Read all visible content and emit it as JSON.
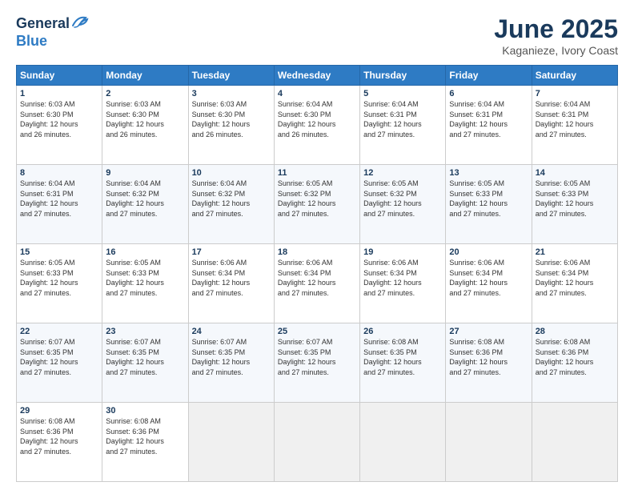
{
  "header": {
    "logo_line1": "General",
    "logo_line2": "Blue",
    "title": "June 2025",
    "subtitle": "Kaganieze, Ivory Coast"
  },
  "days_of_week": [
    "Sunday",
    "Monday",
    "Tuesday",
    "Wednesday",
    "Thursday",
    "Friday",
    "Saturday"
  ],
  "weeks": [
    [
      {
        "day": "1",
        "info": "Sunrise: 6:03 AM\nSunset: 6:30 PM\nDaylight: 12 hours\nand 26 minutes."
      },
      {
        "day": "2",
        "info": "Sunrise: 6:03 AM\nSunset: 6:30 PM\nDaylight: 12 hours\nand 26 minutes."
      },
      {
        "day": "3",
        "info": "Sunrise: 6:03 AM\nSunset: 6:30 PM\nDaylight: 12 hours\nand 26 minutes."
      },
      {
        "day": "4",
        "info": "Sunrise: 6:04 AM\nSunset: 6:30 PM\nDaylight: 12 hours\nand 26 minutes."
      },
      {
        "day": "5",
        "info": "Sunrise: 6:04 AM\nSunset: 6:31 PM\nDaylight: 12 hours\nand 27 minutes."
      },
      {
        "day": "6",
        "info": "Sunrise: 6:04 AM\nSunset: 6:31 PM\nDaylight: 12 hours\nand 27 minutes."
      },
      {
        "day": "7",
        "info": "Sunrise: 6:04 AM\nSunset: 6:31 PM\nDaylight: 12 hours\nand 27 minutes."
      }
    ],
    [
      {
        "day": "8",
        "info": "Sunrise: 6:04 AM\nSunset: 6:31 PM\nDaylight: 12 hours\nand 27 minutes."
      },
      {
        "day": "9",
        "info": "Sunrise: 6:04 AM\nSunset: 6:32 PM\nDaylight: 12 hours\nand 27 minutes."
      },
      {
        "day": "10",
        "info": "Sunrise: 6:04 AM\nSunset: 6:32 PM\nDaylight: 12 hours\nand 27 minutes."
      },
      {
        "day": "11",
        "info": "Sunrise: 6:05 AM\nSunset: 6:32 PM\nDaylight: 12 hours\nand 27 minutes."
      },
      {
        "day": "12",
        "info": "Sunrise: 6:05 AM\nSunset: 6:32 PM\nDaylight: 12 hours\nand 27 minutes."
      },
      {
        "day": "13",
        "info": "Sunrise: 6:05 AM\nSunset: 6:33 PM\nDaylight: 12 hours\nand 27 minutes."
      },
      {
        "day": "14",
        "info": "Sunrise: 6:05 AM\nSunset: 6:33 PM\nDaylight: 12 hours\nand 27 minutes."
      }
    ],
    [
      {
        "day": "15",
        "info": "Sunrise: 6:05 AM\nSunset: 6:33 PM\nDaylight: 12 hours\nand 27 minutes."
      },
      {
        "day": "16",
        "info": "Sunrise: 6:05 AM\nSunset: 6:33 PM\nDaylight: 12 hours\nand 27 minutes."
      },
      {
        "day": "17",
        "info": "Sunrise: 6:06 AM\nSunset: 6:34 PM\nDaylight: 12 hours\nand 27 minutes."
      },
      {
        "day": "18",
        "info": "Sunrise: 6:06 AM\nSunset: 6:34 PM\nDaylight: 12 hours\nand 27 minutes."
      },
      {
        "day": "19",
        "info": "Sunrise: 6:06 AM\nSunset: 6:34 PM\nDaylight: 12 hours\nand 27 minutes."
      },
      {
        "day": "20",
        "info": "Sunrise: 6:06 AM\nSunset: 6:34 PM\nDaylight: 12 hours\nand 27 minutes."
      },
      {
        "day": "21",
        "info": "Sunrise: 6:06 AM\nSunset: 6:34 PM\nDaylight: 12 hours\nand 27 minutes."
      }
    ],
    [
      {
        "day": "22",
        "info": "Sunrise: 6:07 AM\nSunset: 6:35 PM\nDaylight: 12 hours\nand 27 minutes."
      },
      {
        "day": "23",
        "info": "Sunrise: 6:07 AM\nSunset: 6:35 PM\nDaylight: 12 hours\nand 27 minutes."
      },
      {
        "day": "24",
        "info": "Sunrise: 6:07 AM\nSunset: 6:35 PM\nDaylight: 12 hours\nand 27 minutes."
      },
      {
        "day": "25",
        "info": "Sunrise: 6:07 AM\nSunset: 6:35 PM\nDaylight: 12 hours\nand 27 minutes."
      },
      {
        "day": "26",
        "info": "Sunrise: 6:08 AM\nSunset: 6:35 PM\nDaylight: 12 hours\nand 27 minutes."
      },
      {
        "day": "27",
        "info": "Sunrise: 6:08 AM\nSunset: 6:36 PM\nDaylight: 12 hours\nand 27 minutes."
      },
      {
        "day": "28",
        "info": "Sunrise: 6:08 AM\nSunset: 6:36 PM\nDaylight: 12 hours\nand 27 minutes."
      }
    ],
    [
      {
        "day": "29",
        "info": "Sunrise: 6:08 AM\nSunset: 6:36 PM\nDaylight: 12 hours\nand 27 minutes."
      },
      {
        "day": "30",
        "info": "Sunrise: 6:08 AM\nSunset: 6:36 PM\nDaylight: 12 hours\nand 27 minutes."
      },
      {
        "day": "",
        "info": ""
      },
      {
        "day": "",
        "info": ""
      },
      {
        "day": "",
        "info": ""
      },
      {
        "day": "",
        "info": ""
      },
      {
        "day": "",
        "info": ""
      }
    ]
  ]
}
